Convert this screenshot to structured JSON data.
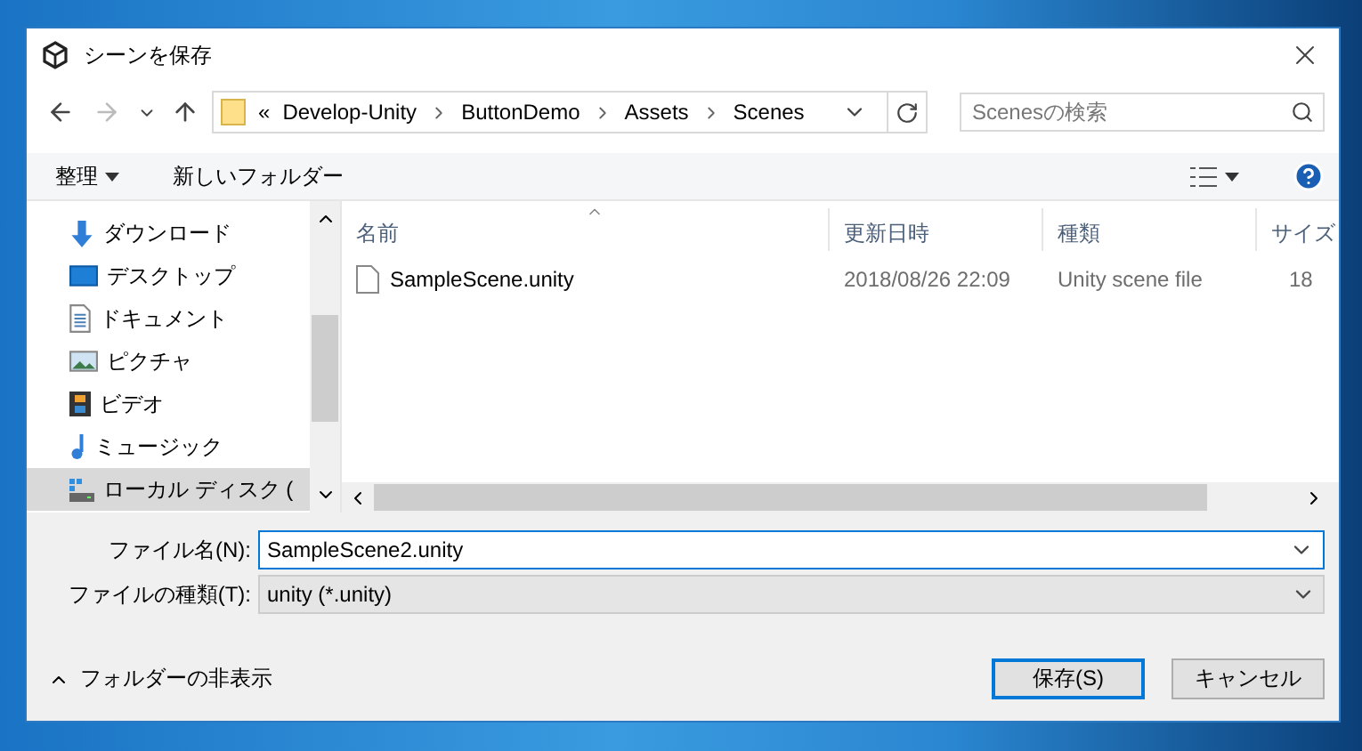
{
  "window": {
    "title": "シーンを保存"
  },
  "address_bar": {
    "overflow": "«",
    "segments": [
      "Develop-Unity",
      "ButtonDemo",
      "Assets",
      "Scenes"
    ]
  },
  "search": {
    "placeholder": "Scenesの検索"
  },
  "toolbar": {
    "organize": "整理",
    "new_folder": "新しいフォルダー"
  },
  "nav_items": [
    {
      "label": "ダウンロード",
      "kind": "download",
      "selected": false
    },
    {
      "label": "デスクトップ",
      "kind": "desktop",
      "selected": false
    },
    {
      "label": "ドキュメント",
      "kind": "documents",
      "selected": false
    },
    {
      "label": "ピクチャ",
      "kind": "pictures",
      "selected": false
    },
    {
      "label": "ビデオ",
      "kind": "videos",
      "selected": false
    },
    {
      "label": "ミュージック",
      "kind": "music",
      "selected": false
    },
    {
      "label": "ローカル ディスク (",
      "kind": "drive",
      "selected": true
    }
  ],
  "columns": [
    {
      "label": "名前",
      "sorted": true
    },
    {
      "label": "更新日時",
      "sorted": false
    },
    {
      "label": "種類",
      "sorted": false
    },
    {
      "label": "サイズ",
      "sorted": false
    }
  ],
  "files": [
    {
      "name": "SampleScene.unity",
      "modified": "2018/08/26 22:09",
      "type": "Unity scene file",
      "size": "18"
    }
  ],
  "file_name": {
    "label": "ファイル名(N):",
    "value": "SampleScene2.unity"
  },
  "file_type": {
    "label": "ファイルの種類(T):",
    "value": "unity (*.unity)"
  },
  "hide_folders": "フォルダーの非表示",
  "buttons": [
    {
      "label": "保存(S)",
      "default": true
    },
    {
      "label": "キャンセル",
      "default": false
    }
  ]
}
